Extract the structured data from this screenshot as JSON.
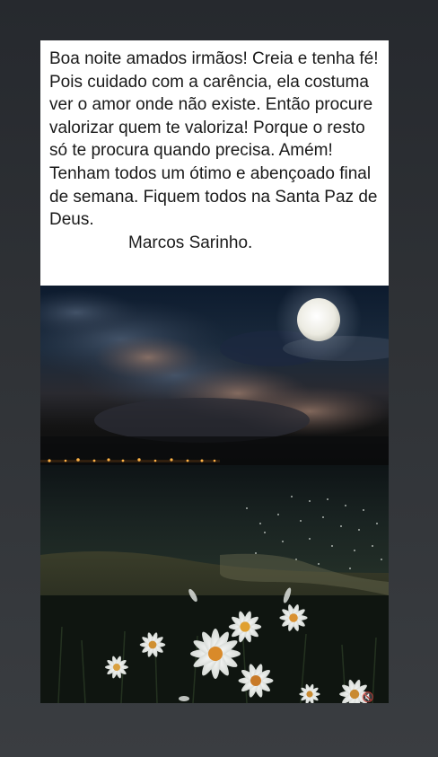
{
  "post": {
    "message": "Boa noite amados irmãos! Creia e tenha fé! Pois cuidado com a carência, ela costuma ver o amor onde não existe. Então procure valorizar quem te valoriza! Porque o resto só te procura quando precisa. Amém! Tenham todos um ótimo e abençoado final de semana. Fiquem todos na Santa Paz de Deus.",
    "signature": "Marcos Sarinho."
  },
  "media": {
    "icon": "volume-mute-icon"
  },
  "colors": {
    "background": "#2c2f33",
    "text_panel": "#ffffff",
    "text": "#1a1a1a",
    "moon": "#f2f0e6",
    "sea": "#1b2420"
  }
}
